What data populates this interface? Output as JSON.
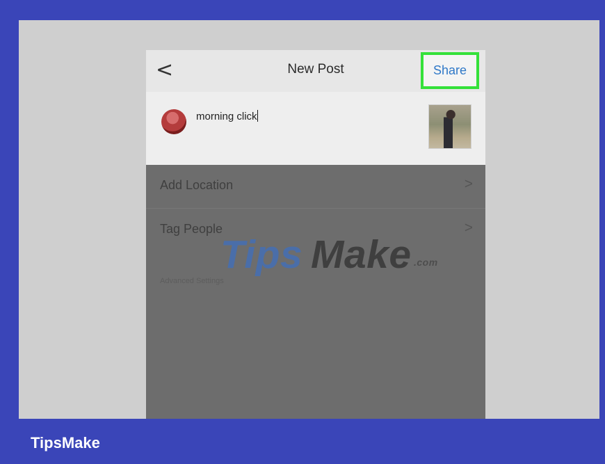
{
  "header": {
    "back_icon": "<",
    "title": "New Post",
    "share_label": "Share"
  },
  "post": {
    "caption": "morning click",
    "avatar_icon": "profile-avatar",
    "thumbnail_icon": "photo-thumbnail"
  },
  "menu": {
    "items": [
      {
        "label": "Add Location",
        "chevron": ">"
      },
      {
        "label": "Tag People",
        "chevron": ">"
      }
    ],
    "advanced_label": "Advanced Settings"
  },
  "watermark": {
    "tips": "Tips",
    "make": "Make",
    "com": ".com"
  },
  "footer": {
    "brand": "TipsMake"
  },
  "colors": {
    "outer_frame": "#3a45b8",
    "highlight": "#35e13a",
    "share_text": "#2f78c8"
  }
}
